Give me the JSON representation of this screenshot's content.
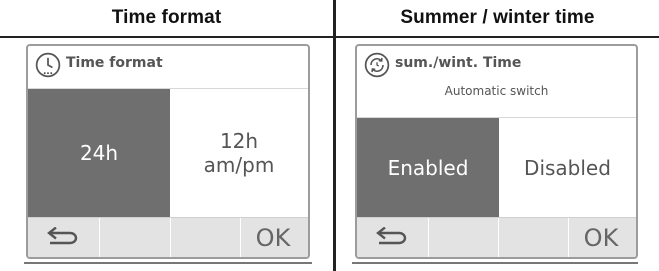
{
  "headers": {
    "left": "Time format",
    "right": "Summer / winter time"
  },
  "left_screen": {
    "icon": "clock-icon",
    "title": "Time format",
    "options": [
      {
        "label": "24h",
        "selected": true
      },
      {
        "label": "12h\nam/pm",
        "selected": false
      }
    ],
    "back_icon": "back-arrow-icon",
    "ok_label": "OK"
  },
  "right_screen": {
    "icon": "dst-clock-icon",
    "title": "sum./wint. Time",
    "subtitle": "Automatic switch",
    "options": [
      {
        "label": "Enabled",
        "selected": true
      },
      {
        "label": "Disabled",
        "selected": false
      }
    ],
    "back_icon": "back-arrow-icon",
    "ok_label": "OK"
  },
  "colors": {
    "selected_bg": "#6f6f6f",
    "bar_bg": "#e3e3e3",
    "text_grey": "#555555"
  }
}
